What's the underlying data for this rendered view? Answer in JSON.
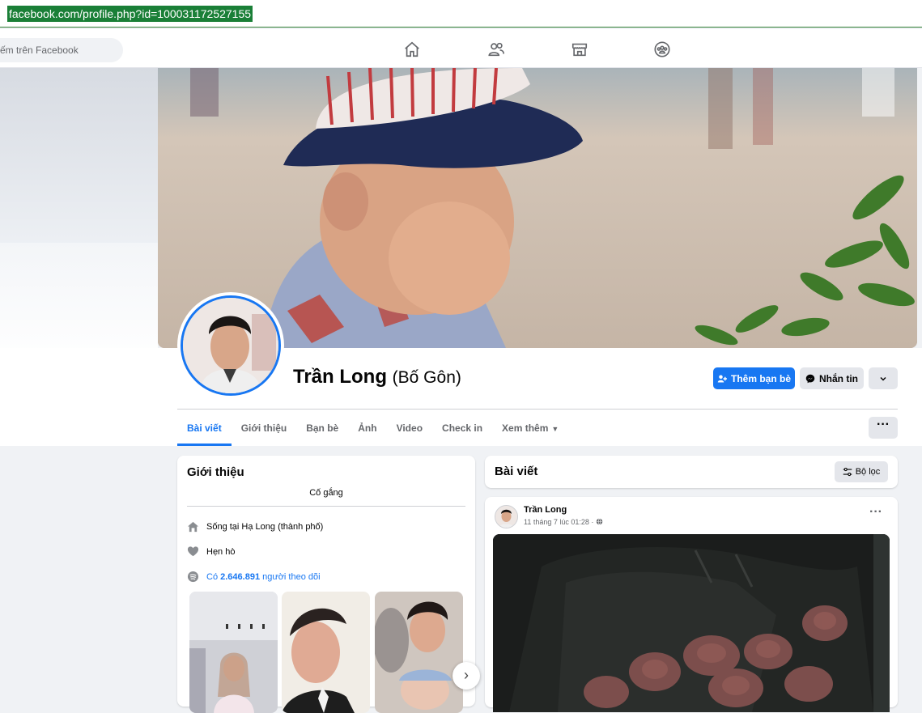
{
  "browser": {
    "url": "facebook.com/profile.php?id=100031172527155"
  },
  "topnav": {
    "search_placeholder": "ếm trên Facebook",
    "icons": [
      "home-icon",
      "friends-icon",
      "marketplace-icon",
      "groups-icon"
    ]
  },
  "profile": {
    "name": "Trần Long",
    "alt_name": "(Bố Gôn)",
    "add_friend_label": "Thêm bạn bè",
    "message_label": "Nhắn tin"
  },
  "tabs": [
    {
      "label": "Bài viết",
      "active": true
    },
    {
      "label": "Giới thiệu"
    },
    {
      "label": "Bạn bè"
    },
    {
      "label": "Ảnh"
    },
    {
      "label": "Video"
    },
    {
      "label": "Check in"
    },
    {
      "label": "Xem thêm"
    }
  ],
  "intro": {
    "title": "Giới thiệu",
    "bio": "Cố gắng",
    "lives_prefix": "Sống tại ",
    "lives_place": "Hạ Long (thành phố)",
    "relationship": "Hẹn hò",
    "followers_prefix": "Có ",
    "followers_count": "2.646.891",
    "followers_suffix": " người theo dõi"
  },
  "posts": {
    "title": "Bài viết",
    "filter_label": "Bộ lọc",
    "first_post": {
      "author": "Trần Long",
      "meta": "11 tháng 7 lúc 01:28 · "
    }
  },
  "colors": {
    "accent": "#1877f2",
    "url_highlight": "#1a7f37"
  }
}
